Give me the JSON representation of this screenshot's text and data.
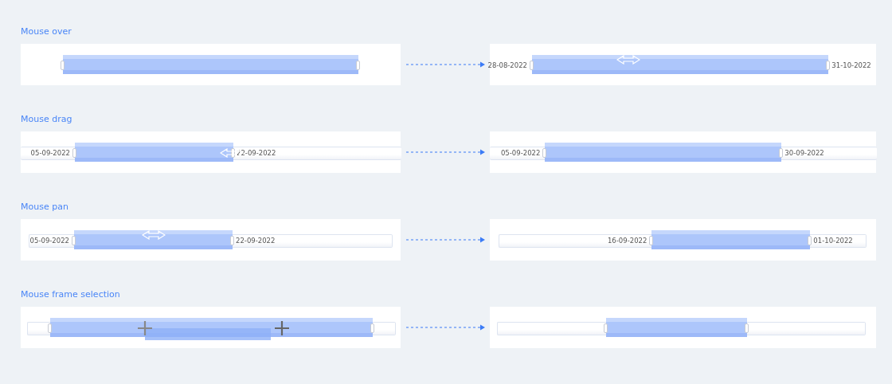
{
  "sections": [
    {
      "title": "Mouse over",
      "after": {
        "start_label": "28-08-2022",
        "end_label": "31-10-2022"
      }
    },
    {
      "title": "Mouse drag",
      "before": {
        "start_label": "05-09-2022",
        "end_label": "22-09-2022"
      },
      "after": {
        "start_label": "05-09-2022",
        "end_label": "30-09-2022"
      }
    },
    {
      "title": "Mouse pan",
      "before": {
        "start_label": "05-09-2022",
        "end_label": "22-09-2022"
      },
      "after": {
        "start_label": "16-09-2022",
        "end_label": "01-10-2022"
      }
    },
    {
      "title": "Mouse frame selection"
    }
  ]
}
